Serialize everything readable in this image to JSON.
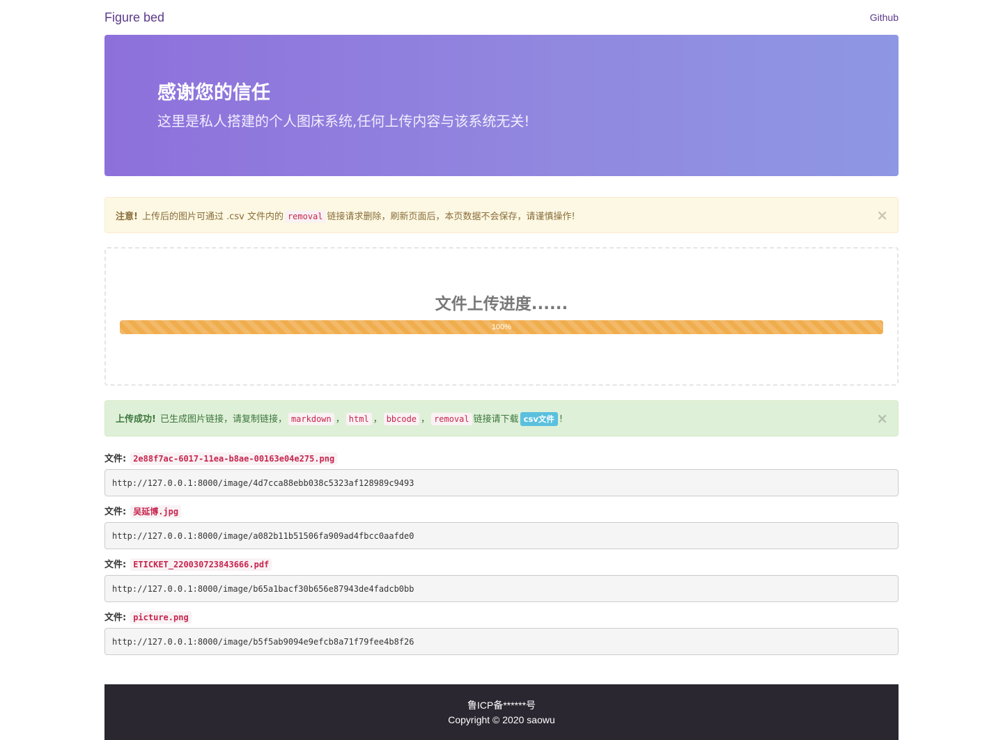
{
  "navbar": {
    "brand": "Figure bed",
    "github_link": "Github"
  },
  "hero": {
    "title": "感谢您的信任",
    "subtitle": "这里是私人搭建的个人图床系统,任何上传内容与该系统无关!"
  },
  "warning_alert": {
    "strong": "注意!",
    "text_before": "上传后的图片可通过 .csv 文件内的",
    "code": "removal",
    "text_after": "链接请求删除，刷新页面后，本页数据不会保存，请谨慎操作!",
    "close": "×"
  },
  "upload": {
    "title": "文件上传进度......",
    "progress_percent": 100,
    "progress_label": "100%"
  },
  "success_alert": {
    "strong": "上传成功!",
    "text_before": "已生成图片链接，请复制链接，",
    "code_markdown": "markdown",
    "code_html": "html",
    "code_bbcode": "bbcode",
    "code_removal": "removal",
    "separator": "，",
    "text_link": "链接请下载",
    "csv_label": "csv文件",
    "text_end": "!",
    "close": "×"
  },
  "files": [
    {
      "label": "文件:",
      "name": "2e88f7ac-6017-11ea-b8ae-00163e04e275.png",
      "url": "http://127.0.0.1:8000/image/4d7cca88ebb038c5323af128989c9493"
    },
    {
      "label": "文件:",
      "name": "吴延博.jpg",
      "url": "http://127.0.0.1:8000/image/a082b11b51506fa909ad4fbcc0aafde0"
    },
    {
      "label": "文件:",
      "name": "ETICKET_220030723843666.pdf",
      "url": "http://127.0.0.1:8000/image/b65a1bacf30b656e87943de4fadcb0bb"
    },
    {
      "label": "文件:",
      "name": "picture.png",
      "url": "http://127.0.0.1:8000/image/b5f5ab9094e9efcb8a71f79fee4b8f26"
    }
  ],
  "footer": {
    "icp": "鲁ICP备******号",
    "copyright": "Copyright © 2020 saowu"
  },
  "colors": {
    "hero_gradient_start": "#8e70db",
    "hero_gradient_end": "#8e97e3",
    "warning_bg": "#fcf8e3",
    "success_bg": "#dff0d8",
    "progress_bar": "#f0ad4e",
    "footer_bg": "#2a2730"
  }
}
